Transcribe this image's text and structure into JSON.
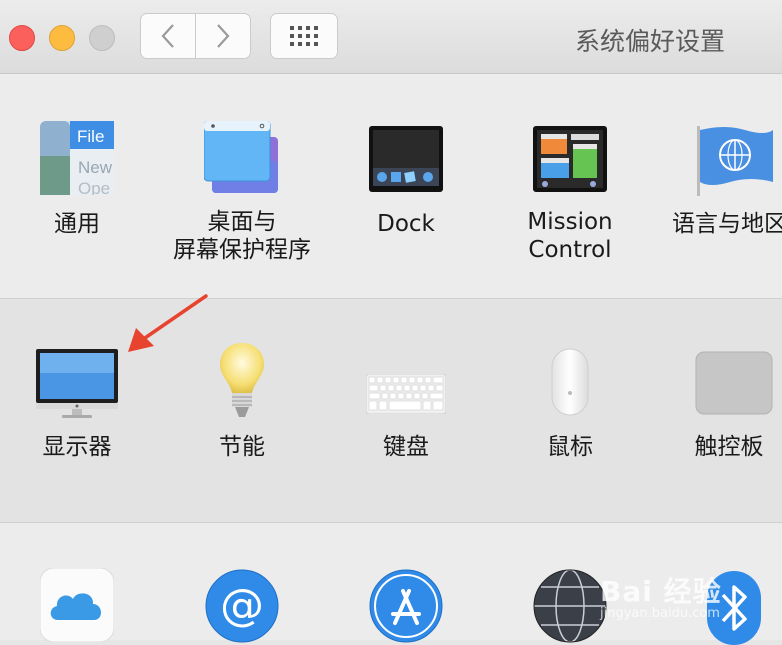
{
  "window": {
    "title": "系统偏好设置"
  },
  "rows": [
    {
      "panes": [
        {
          "label": "通用",
          "icon": "general-icon",
          "icon_text": [
            "File",
            "New",
            "Ope"
          ]
        },
        {
          "label": "桌面与\n屏幕保护程序",
          "icon": "desktop-screensaver-icon"
        },
        {
          "label": "Dock",
          "icon": "dock-icon"
        },
        {
          "label": "Mission\nControl",
          "icon": "mission-control-icon"
        },
        {
          "label": "语言与地区",
          "icon": "language-region-icon"
        }
      ]
    },
    {
      "panes": [
        {
          "label": "显示器",
          "icon": "display-icon"
        },
        {
          "label": "节能",
          "icon": "energy-saver-icon"
        },
        {
          "label": "键盘",
          "icon": "keyboard-icon"
        },
        {
          "label": "鼠标",
          "icon": "mouse-icon"
        },
        {
          "label": "触控板",
          "icon": "trackpad-icon"
        }
      ]
    },
    {
      "panes": [
        {
          "icon": "icloud-icon"
        },
        {
          "icon": "internet-accounts-icon"
        },
        {
          "icon": "app-store-icon"
        },
        {
          "icon": "network-icon"
        },
        {
          "icon": "bluetooth-icon"
        }
      ]
    }
  ],
  "annotation": {
    "icon": "red-arrow-icon",
    "color": "#e8432f"
  },
  "watermark": {
    "text": "Bai 经验",
    "subtext": "jingyan.baidu.com"
  }
}
